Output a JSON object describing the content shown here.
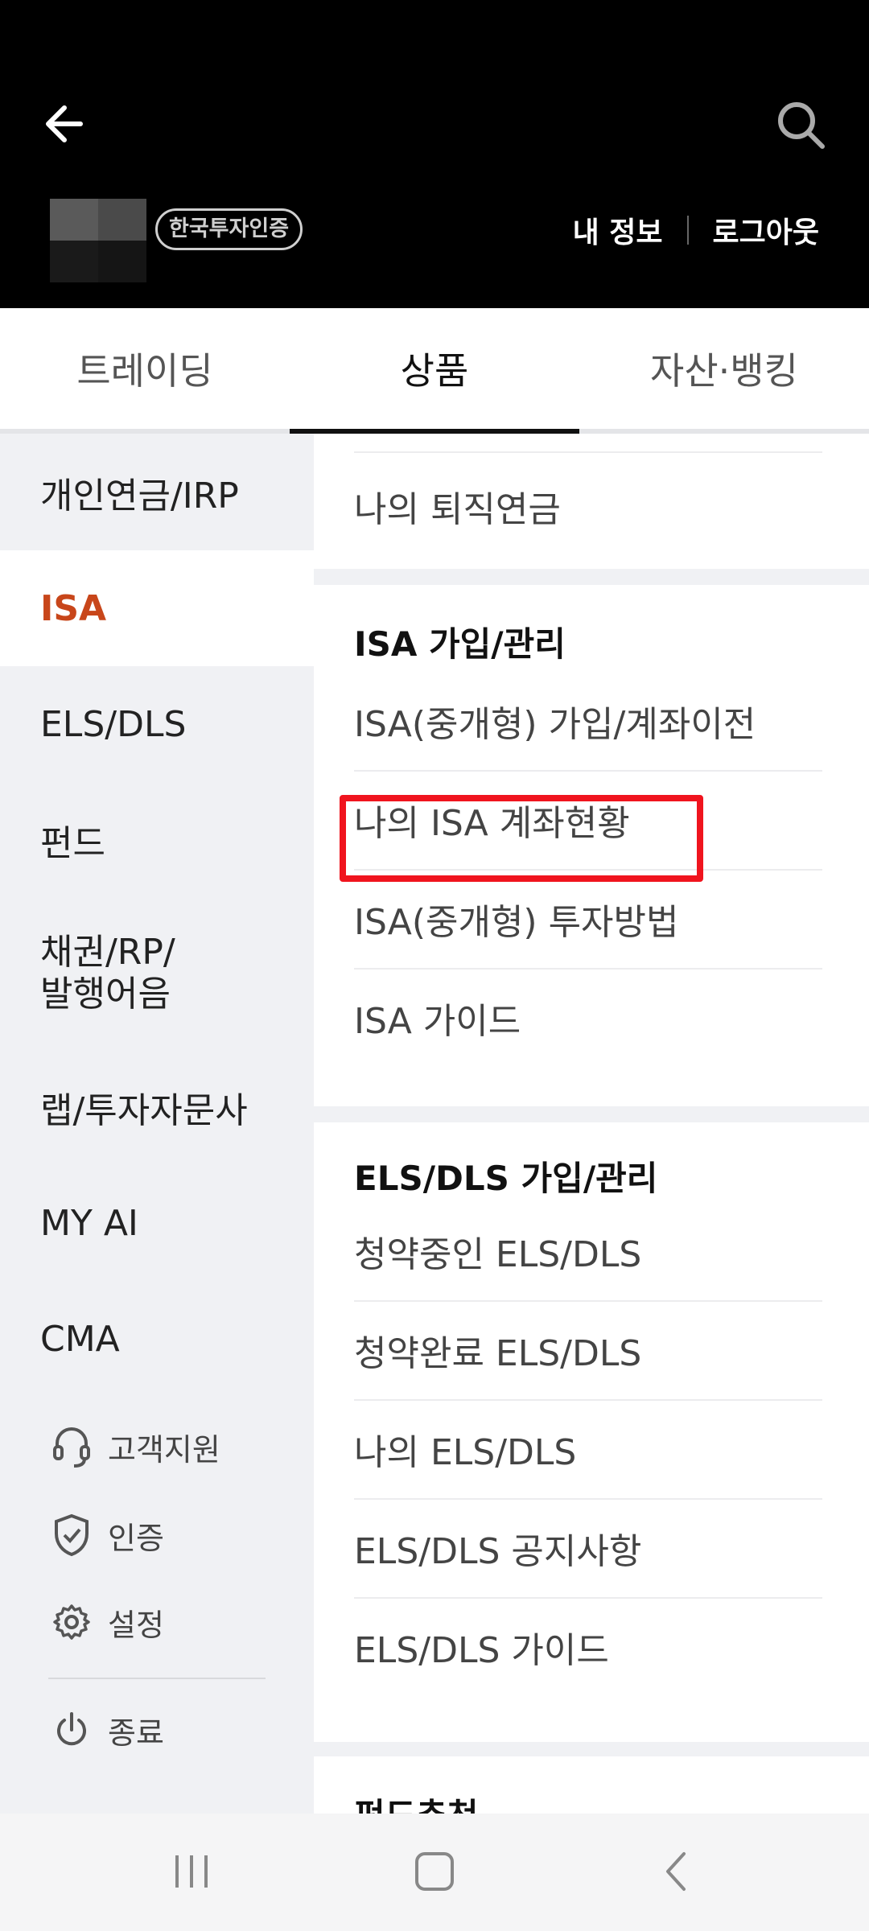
{
  "header": {
    "cert_badge": "한국투자인증",
    "my_info": "내 정보",
    "logout": "로그아웃"
  },
  "tabs": [
    {
      "label": "트레이딩"
    },
    {
      "label": "상품"
    },
    {
      "label": "자산·뱅킹"
    }
  ],
  "leftnav": {
    "items": [
      {
        "label": "개인연금/IRP"
      },
      {
        "label": "ISA"
      },
      {
        "label": "ELS/DLS"
      },
      {
        "label": "펀드"
      },
      {
        "label": "채권/RP/\n발행어음"
      },
      {
        "label": "랩/투자자문사"
      },
      {
        "label": "MY AI"
      },
      {
        "label": "CMA"
      }
    ],
    "utilities": {
      "support": "고객지원",
      "auth": "인증",
      "settings": "설정",
      "exit": "종료"
    }
  },
  "content": {
    "top_item": "나의 퇴직연금",
    "isa": {
      "title": "ISA 가입/관리",
      "items": [
        "ISA(중개형) 가입/계좌이전",
        "나의 ISA 계좌현황",
        "ISA(중개형) 투자방법",
        "ISA 가이드"
      ]
    },
    "els": {
      "title": "ELS/DLS 가입/관리",
      "items": [
        "청약중인 ELS/DLS",
        "청약완료 ELS/DLS",
        "나의 ELS/DLS",
        "ELS/DLS 공지사항",
        "ELS/DLS 가이드"
      ]
    },
    "fund": {
      "title": "펀드추천"
    }
  },
  "colors": {
    "accent": "#c8461a",
    "highlight_box": "#f0141e",
    "header_bg": "#000000"
  },
  "icons": [
    "back-arrow-icon",
    "search-icon",
    "headset-icon",
    "shield-check-icon",
    "gear-icon",
    "power-icon",
    "recent-apps-icon",
    "home-icon",
    "back-icon"
  ]
}
